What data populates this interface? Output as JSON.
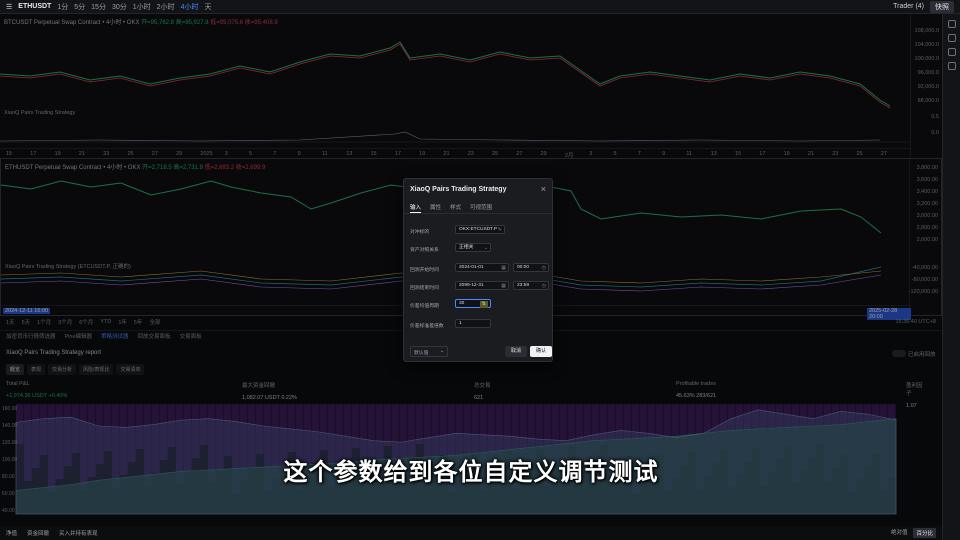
{
  "topbar": {
    "symbol": "ETHUSDT",
    "timeframes": [
      "1分",
      "5分",
      "15分",
      "30分",
      "1小时",
      "2小时",
      "4小时",
      "天"
    ],
    "active_timeframe": "4小时",
    "right_label": "Trader (4)",
    "share_button": "快照"
  },
  "pane1": {
    "title": "BTCUSDT Perpetual Swap Contract • 4小时 • OKX",
    "ohlc": [
      "开=95,762.8",
      "高=95,927.8",
      "低=95,075.6",
      "收=95,408.9"
    ],
    "prices": [
      "108,000.0",
      "104,000.0",
      "100,000.0",
      "96,000.0",
      "92,000.0",
      "88,000.0"
    ],
    "indicator_label": "XiaoQ Pairs Trading Strategy",
    "indicator_values": [
      "0.5",
      "0.0"
    ],
    "dates": [
      "15",
      "17",
      "19",
      "21",
      "23",
      "25",
      "27",
      "29",
      "2025",
      "3",
      "5",
      "7",
      "9",
      "11",
      "13",
      "15",
      "17",
      "19",
      "21",
      "23",
      "25",
      "27",
      "29",
      "2月",
      "3",
      "5",
      "7",
      "9",
      "11",
      "13",
      "15",
      "17",
      "19",
      "21",
      "23",
      "25",
      "27"
    ]
  },
  "pane2": {
    "title": "ETHUSDT Perpetual Swap Contract • 4小时 • OKX",
    "ohlc": [
      "开=2,718.5",
      "高=2,731.9",
      "低=2,693.2",
      "收=2,699.9"
    ],
    "prices": [
      "3,800.00",
      "3,600.00",
      "3,400.00",
      "3,200.00",
      "3,000.00",
      "2,800.00",
      "2,600.00"
    ],
    "indicator_label": "XiaoQ Pairs Trading Strategy (ETCUSDT.P, 正确的)",
    "indicator_values": [
      "-40,000.00",
      "-80,000.00",
      "-120,000.00"
    ],
    "left_date": "2024-12-11",
    "left_time": "16:00",
    "right_date": "2025-02-28",
    "right_time": "20:00"
  },
  "tfbar": {
    "items": [
      "1天",
      "5天",
      "1个月",
      "3个月",
      "6个月",
      "YTD",
      "1年",
      "5年",
      "全部"
    ],
    "clock": "15:36:40 UTC+8"
  },
  "tabs": {
    "items": [
      "加密货币行情筛选器",
      "Pine编辑器",
      "策略测试器",
      "回放交易面板",
      "交易面板"
    ],
    "active": "策略测试器"
  },
  "report": {
    "title": "XiaoQ Pairs Trading Strategy report",
    "toggle_label": "已启用回放",
    "subtabs": [
      "概览",
      "表现",
      "交易分析",
      "风险/表现比",
      "交易清单"
    ],
    "stats": [
      {
        "label": "Total P&L",
        "value": "+1,974.36 USDT +0.40%",
        "green": true
      },
      {
        "label": "最大资金回撤",
        "value": "1,082.07 USDT 0.22%",
        "green": false
      },
      {
        "label": "总交易",
        "value": "621",
        "green": false
      },
      {
        "label": "Profitable trades",
        "value": "45.63% 283/621",
        "green": false
      },
      {
        "label": "盈利因子",
        "value": "1.07",
        "green": false
      }
    ],
    "perf_axis": [
      "160.00",
      "140.00",
      "120.00",
      "100.00",
      "80.00",
      "60.00",
      "40.00"
    ],
    "bottom": [
      "净值",
      "资金回撤",
      "买入并持有表现"
    ],
    "bottom_right": [
      "绝对值",
      "百分比"
    ]
  },
  "dialog": {
    "title": "XiaoQ Pairs Trading Strategy",
    "tabs": [
      "输入",
      "属性",
      "样式",
      "可视范围"
    ],
    "active_tab": "输入",
    "rows": [
      {
        "label": "对冲标的",
        "value": "OKX:ETCUSDT.P"
      },
      {
        "label": "资产对照关系",
        "value": "正相关"
      },
      {
        "label": "回测开始时间",
        "value": "2024-01-01",
        "time": "00:00"
      },
      {
        "label": "回测结束时间",
        "value": "2099-12-31",
        "time": "23:59"
      },
      {
        "label": "价差均值周期",
        "value": "30"
      },
      {
        "label": "价差标准差倍数",
        "value": "1"
      }
    ],
    "defaults": "默认值",
    "cancel": "取消",
    "ok": "确认"
  },
  "caption": "这个参数给到各位自定义调节测试",
  "chart_data": {
    "type": "area",
    "title": "XiaoQ Pairs Trading Strategy report",
    "ylim": [
      20,
      170
    ],
    "series": [
      {
        "name": "净值",
        "values": [
          52,
          56,
          60,
          66,
          70,
          74,
          78,
          80,
          82,
          84,
          86,
          88,
          90,
          94,
          96,
          98,
          100,
          104,
          108,
          112,
          116,
          120,
          122,
          124,
          126,
          130,
          134,
          136,
          138,
          140,
          142,
          146,
          150
        ]
      },
      {
        "name": "买入并持有表现",
        "values": [
          145,
          150,
          152,
          140,
          138,
          142,
          148,
          150,
          146,
          140,
          136,
          132,
          126,
          120,
          118,
          124,
          130,
          128,
          126,
          122,
          120,
          128,
          134,
          130,
          124,
          130,
          150,
          162,
          156,
          150,
          160,
          156,
          148
        ]
      }
    ]
  }
}
